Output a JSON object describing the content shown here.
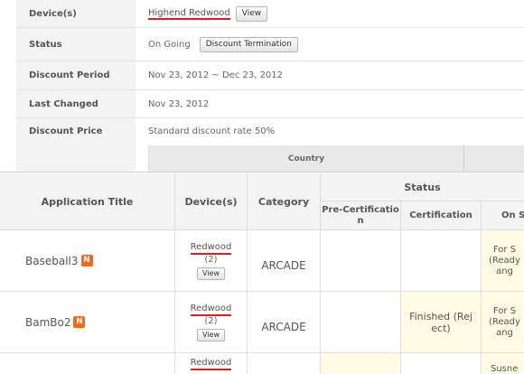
{
  "info": {
    "device": {
      "label": "Device(s)",
      "value": "Highend Redwood",
      "button": "View"
    },
    "status": {
      "label": "Status",
      "value": "On Going",
      "button": "Discount Termination"
    },
    "period": {
      "label": "Discount Period",
      "value": "Nov 23, 2012 ~ Dec 23, 2012"
    },
    "changed": {
      "label": "Last Changed",
      "value": "Nov 23, 2012"
    },
    "price": {
      "label": "Discount Price",
      "value": "Standard discount rate 50%"
    },
    "country_header": "Country"
  },
  "apps": {
    "headers": {
      "title": "Application Title",
      "devices": "Device(s)",
      "category": "Category",
      "status": "Status",
      "pre_cert": "Pre-Certificatio\nn",
      "cert": "Certification",
      "on_sale": "On S"
    },
    "rows": [
      {
        "title": "Baseball3",
        "badge": "N",
        "device": "Redwood",
        "count": "(2)",
        "view": "View",
        "category": "ARCADE",
        "pre_cert": "",
        "cert": "",
        "on_sale": "For S\n(Ready\nang"
      },
      {
        "title": "BamBo2",
        "badge": "N",
        "device": "Redwood",
        "count": "(2)",
        "view": "View",
        "category": "ARCADE",
        "pre_cert": "",
        "cert": "Finished (Rej\nect)",
        "on_sale": "For S\n(Ready\nang"
      },
      {
        "title": "",
        "badge": "",
        "device": "Redwood",
        "count": "",
        "view": "",
        "category": "",
        "pre_cert": "",
        "cert": "",
        "on_sale": "Susne"
      }
    ]
  }
}
